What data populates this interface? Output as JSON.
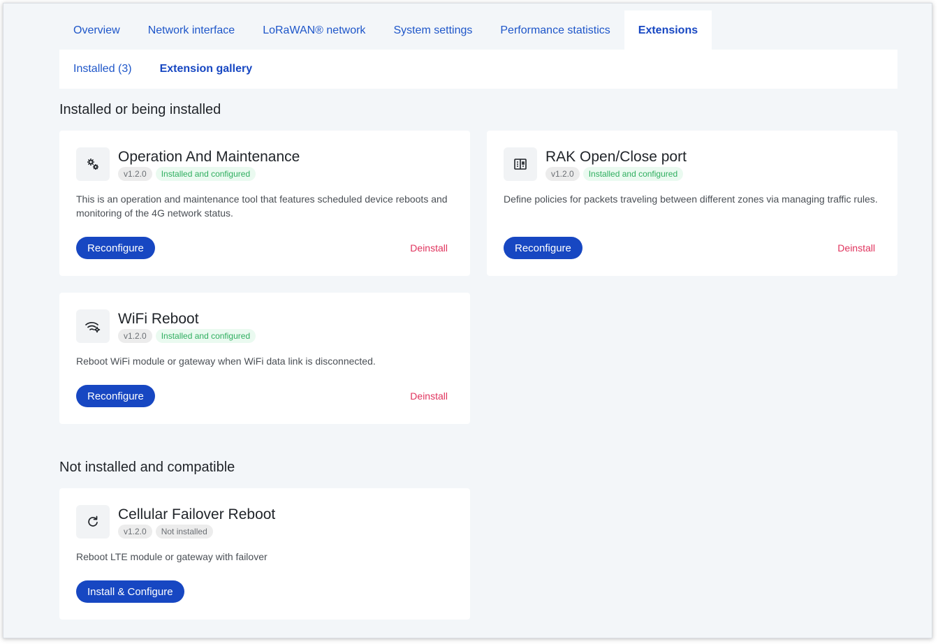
{
  "main_tabs": [
    {
      "label": "Overview"
    },
    {
      "label": "Network interface"
    },
    {
      "label": "LoRaWAN® network"
    },
    {
      "label": "System settings"
    },
    {
      "label": "Performance statistics"
    },
    {
      "label": "Extensions",
      "active": true
    }
  ],
  "sub_tabs": [
    {
      "label": "Installed (3)"
    },
    {
      "label": "Extension gallery",
      "active": true
    }
  ],
  "sections": {
    "installed_title": "Installed or being installed",
    "not_installed_title": "Not installed and compatible"
  },
  "installed_extensions": [
    {
      "icon": "gears-icon",
      "title": "Operation And Maintenance",
      "version": "v1.2.0",
      "status": "Installed and configured",
      "description": "This is an operation and maintenance tool that features scheduled device reboots and monitoring of the 4G network status.",
      "primary_action": "Reconfigure",
      "secondary_action": "Deinstall"
    },
    {
      "icon": "port-icon",
      "title": "RAK Open/Close port",
      "version": "v1.2.0",
      "status": "Installed and configured",
      "description": "Define policies for packets traveling between different zones via managing traffic rules.",
      "primary_action": "Reconfigure",
      "secondary_action": "Deinstall"
    },
    {
      "icon": "wifi-gear-icon",
      "title": "WiFi Reboot",
      "version": "v1.2.0",
      "status": "Installed and configured",
      "description": "Reboot WiFi module or gateway when WiFi data link is disconnected.",
      "primary_action": "Reconfigure",
      "secondary_action": "Deinstall"
    }
  ],
  "available_extensions": [
    {
      "icon": "refresh-icon",
      "title": "Cellular Failover Reboot",
      "version": "v1.2.0",
      "status": "Not installed",
      "description": "Reboot LTE module or gateway with failover",
      "primary_action": "Install & Configure"
    }
  ],
  "colors": {
    "accent": "#1747c2",
    "danger": "#e0335d",
    "success": "#2fae5f",
    "background": "#f3f6f9"
  }
}
